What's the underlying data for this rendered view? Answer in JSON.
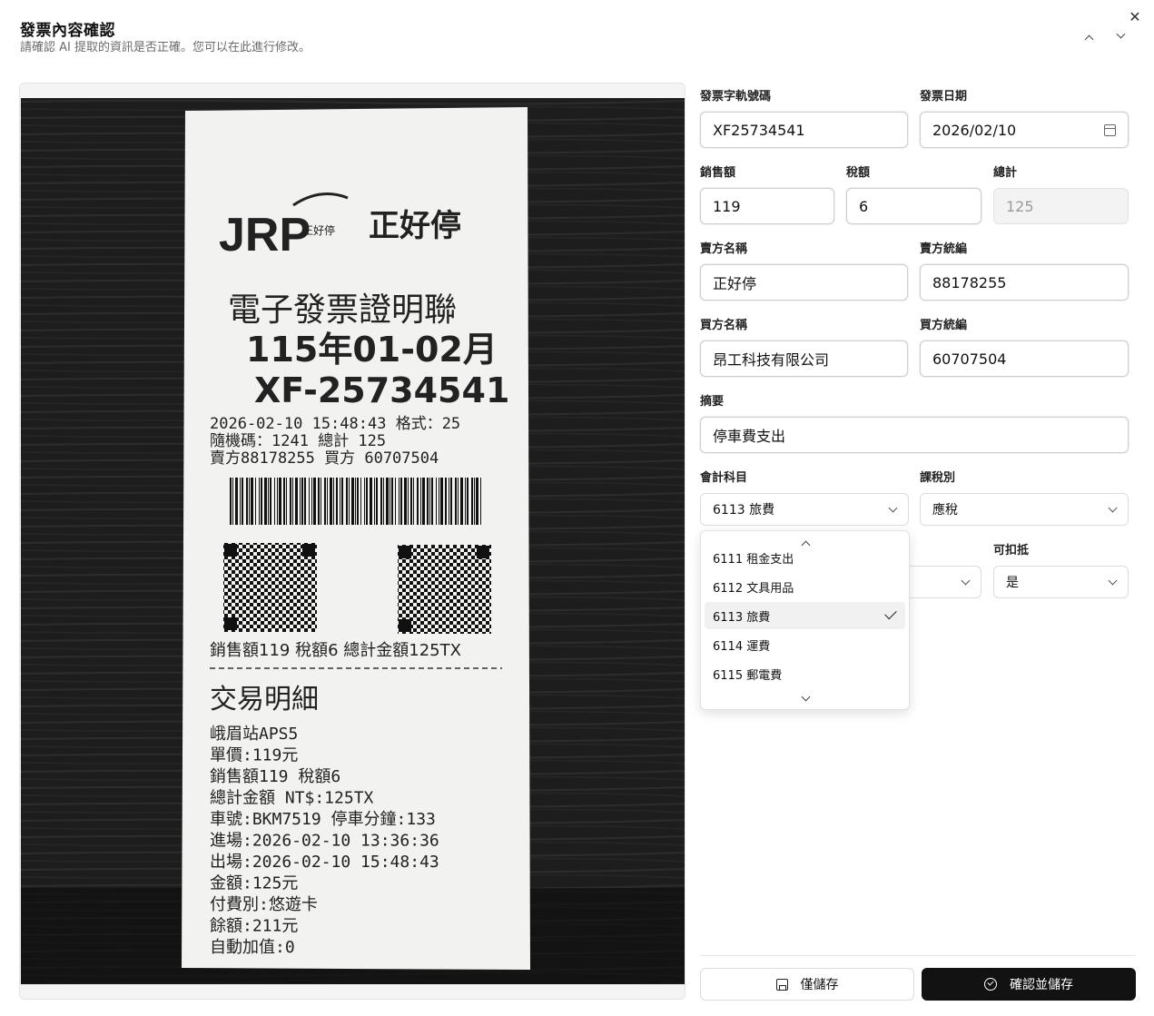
{
  "dialog": {
    "title": "發票內容確認",
    "subtitle": "請確認 AI 提取的資訊是否正確。您可以在此進行修改。"
  },
  "receipt": {
    "brand": "JRP",
    "brand_small": "正好停",
    "brand_name": "正好停",
    "heading": "電子發票證明聯",
    "period": "115年01-02月",
    "number": "XF-25734541",
    "line1": "2026-02-10 15:48:43 格式：25",
    "line2": "隨機碼：1241     總計 125",
    "line3": "賣方88178255  買方 60707504",
    "totals": "銷售額119 稅額6 總計金額125TX",
    "detail_title": "交易明細",
    "detail_lines": [
      "峨眉站APS5",
      "單價:119元",
      "銷售額119 稅額6",
      "總計金額 NT$:125TX",
      "車號:BKM7519 停車分鐘:133",
      "進場:2026-02-10 13:36:36",
      "出場:2026-02-10 15:48:43",
      "金額:125元",
      "付費別:悠遊卡",
      "餘額:211元",
      "自動加值:0"
    ]
  },
  "form": {
    "invoice_number": {
      "label": "發票字軌號碼",
      "value": "XF25734541"
    },
    "invoice_date": {
      "label": "發票日期",
      "value": "2026/02/10"
    },
    "sales_amount": {
      "label": "銷售額",
      "value": "119"
    },
    "tax_amount": {
      "label": "稅額",
      "value": "6"
    },
    "total": {
      "label": "總計",
      "value": "125"
    },
    "seller_name": {
      "label": "賣方名稱",
      "value": "正好停"
    },
    "seller_id": {
      "label": "賣方統編",
      "value": "88178255"
    },
    "buyer_name": {
      "label": "買方名稱",
      "value": "昂工科技有限公司"
    },
    "buyer_id": {
      "label": "買方統編",
      "value": "60707504"
    },
    "summary": {
      "label": "摘要",
      "value": "停車費支出"
    },
    "account": {
      "label": "會計科目",
      "value": "6113 旅費"
    },
    "tax_type": {
      "label": "課稅別",
      "value": "應稅"
    },
    "deductible": {
      "label": "可扣抵",
      "value": "是"
    }
  },
  "account_options": [
    {
      "label": "6111 租金支出",
      "selected": false
    },
    {
      "label": "6112 文具用品",
      "selected": false
    },
    {
      "label": "6113 旅費",
      "selected": true
    },
    {
      "label": "6114 運費",
      "selected": false
    },
    {
      "label": "6115 郵電費",
      "selected": false
    }
  ],
  "buttons": {
    "save_only": "僅儲存",
    "confirm_save": "確認並儲存"
  },
  "icons": [
    "close-icon",
    "chevron-up-icon",
    "chevron-down-icon",
    "calendar-icon",
    "save-icon",
    "check-circle-icon"
  ]
}
